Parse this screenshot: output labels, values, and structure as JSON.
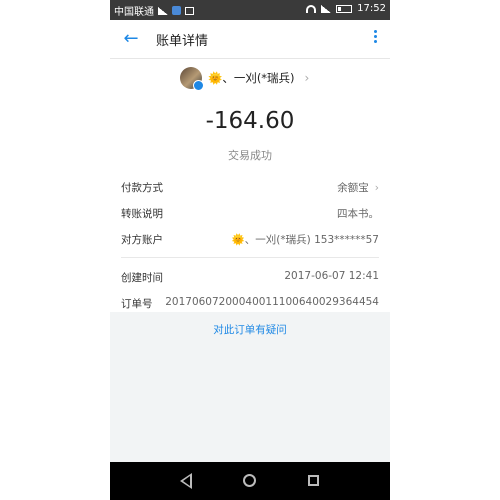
{
  "status_bar": {
    "carrier": "中国联通",
    "time": "17:52"
  },
  "app_bar": {
    "title": "账单详情",
    "back_icon": "arrow-left-icon",
    "more_icon": "more-vertical-icon"
  },
  "profile": {
    "name": "🌞、一刈(*瑞兵)",
    "chevron": "›"
  },
  "transaction": {
    "amount": "-164.60",
    "status": "交易成功"
  },
  "details": [
    {
      "label": "付款方式",
      "value": "余额宝",
      "has_arrow": true
    },
    {
      "label": "转账说明",
      "value": "四本书。"
    },
    {
      "label": "对方账户",
      "value": "🌞、一刈(*瑞兵) 153******57"
    }
  ],
  "details2": [
    {
      "label": "创建时间",
      "value": "2017-06-07 12:41"
    },
    {
      "label": "订单号",
      "value": "20170607200040011100640029364454"
    }
  ],
  "footer": {
    "doubt_link": "对此订单有疑问"
  },
  "colors": {
    "accent": "#1e88e5",
    "status_bar": "#3a3a3a",
    "nav_bar": "#000000"
  }
}
